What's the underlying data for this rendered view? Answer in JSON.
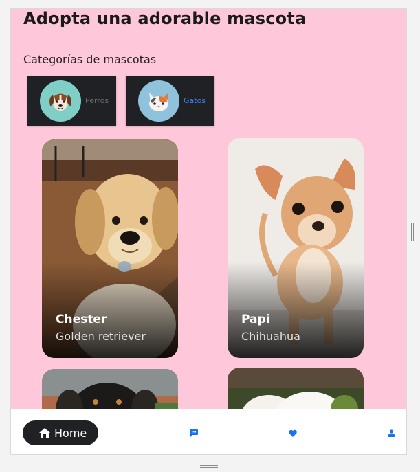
{
  "header": {
    "title": "Adopta una adorable mascota"
  },
  "categories": {
    "heading": "Categorías de mascotas",
    "items": [
      {
        "label": "Perros",
        "icon": "dog-face-icon",
        "circle_color": "#7fcfc6",
        "label_color": "#6b6b6b"
      },
      {
        "label": "Gatos",
        "icon": "cat-face-icon",
        "circle_color": "#8fc3dc",
        "label_color": "#3b82f6"
      }
    ]
  },
  "pets": [
    {
      "name": "Chester",
      "breed": "Golden retriever"
    },
    {
      "name": "Papi",
      "breed": "Chihuahua"
    },
    {
      "name": "",
      "breed": ""
    },
    {
      "name": "",
      "breed": ""
    }
  ],
  "nav": {
    "home_label": "Home",
    "items": [
      {
        "icon": "home-icon"
      },
      {
        "icon": "chat-icon"
      },
      {
        "icon": "heart-icon"
      },
      {
        "icon": "person-icon"
      }
    ],
    "accent": "#1a73e8"
  }
}
